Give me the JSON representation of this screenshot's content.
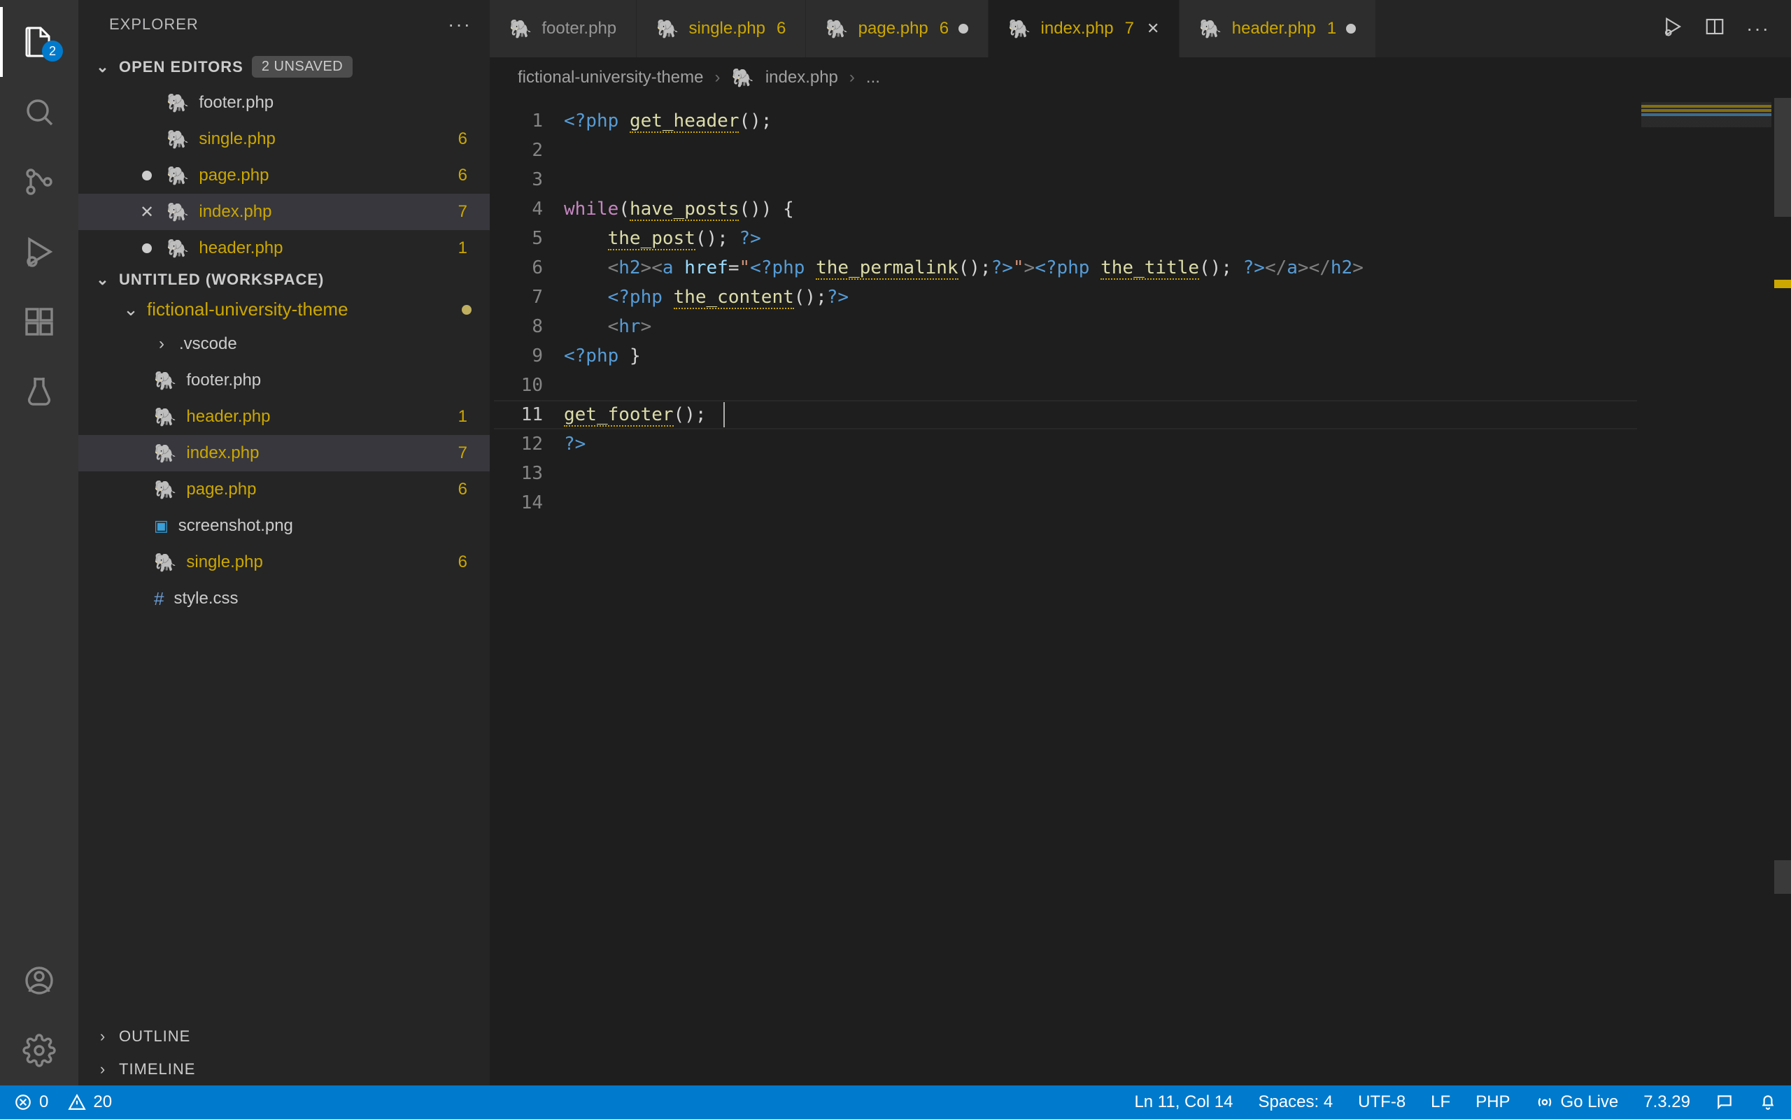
{
  "sidebar": {
    "title": "EXPLORER",
    "openEditors": {
      "header": "OPEN EDITORS",
      "unsaved": "2 UNSAVED",
      "items": [
        {
          "name": "footer.php",
          "mod": false,
          "dirty": false,
          "badge": ""
        },
        {
          "name": "single.php",
          "mod": true,
          "dirty": false,
          "badge": "6"
        },
        {
          "name": "page.php",
          "mod": true,
          "dirty": true,
          "badge": "6"
        },
        {
          "name": "index.php",
          "mod": true,
          "dirty": false,
          "badge": "7",
          "active": true
        },
        {
          "name": "header.php",
          "mod": true,
          "dirty": true,
          "badge": "1"
        }
      ]
    },
    "workspace": {
      "header": "UNTITLED (WORKSPACE)",
      "project": "fictional-university-theme",
      "items": [
        {
          "name": ".vscode",
          "type": "folder"
        },
        {
          "name": "footer.php",
          "type": "php"
        },
        {
          "name": "header.php",
          "type": "php",
          "mod": true,
          "badge": "1"
        },
        {
          "name": "index.php",
          "type": "php",
          "mod": true,
          "badge": "7",
          "active": true
        },
        {
          "name": "page.php",
          "type": "php",
          "mod": true,
          "badge": "6"
        },
        {
          "name": "screenshot.png",
          "type": "img"
        },
        {
          "name": "single.php",
          "type": "php",
          "mod": true,
          "badge": "6"
        },
        {
          "name": "style.css",
          "type": "css"
        }
      ]
    },
    "outline": "OUTLINE",
    "timeline": "TIMELINE"
  },
  "tabs": [
    {
      "name": "footer.php",
      "mod": false,
      "badge": "",
      "dirty": false
    },
    {
      "name": "single.php",
      "mod": true,
      "badge": "6",
      "dirty": false
    },
    {
      "name": "page.php",
      "mod": true,
      "badge": "6",
      "dirty": true
    },
    {
      "name": "index.php",
      "mod": true,
      "badge": "7",
      "dirty": false,
      "active": true
    },
    {
      "name": "header.php",
      "mod": true,
      "badge": "1",
      "dirty": true
    }
  ],
  "breadcrumbs": {
    "root": "fictional-university-theme",
    "file": "index.php",
    "tail": "..."
  },
  "code": {
    "lines": [
      {
        "n": 1,
        "html": "<span class='tok-tag'>&lt;?php</span> <span class='tok-fn'>get_header</span><span class='tok-paren'>()</span><span class='tok-var'>;</span>"
      },
      {
        "n": 2,
        "html": ""
      },
      {
        "n": 3,
        "html": ""
      },
      {
        "n": 4,
        "html": "<span class='tok-kw'>while</span><span class='tok-paren'>(</span><span class='tok-fn'>have_posts</span><span class='tok-paren'>())</span> <span class='tok-paren'>{</span>"
      },
      {
        "n": 5,
        "html": "    <span class='tok-fn'>the_post</span><span class='tok-paren'>()</span><span class='tok-var'>;</span> <span class='tok-tag'>?&gt;</span>"
      },
      {
        "n": 6,
        "html": "    <span class='tok-delim'>&lt;</span><span class='tok-tag'>h2</span><span class='tok-delim'>&gt;&lt;</span><span class='tok-tag'>a</span> <span class='tok-attr'>href</span><span class='tok-var'>=</span><span class='tok-str'>\"</span><span class='tok-tag'>&lt;?php</span> <span class='tok-fn'>the_permalink</span><span class='tok-paren'>()</span><span class='tok-var'>;</span><span class='tok-tag'>?&gt;</span><span class='tok-str'>\"</span><span class='tok-delim'>&gt;</span><span class='tok-tag'>&lt;?php</span> <span class='tok-fn'>the_title</span><span class='tok-paren'>()</span><span class='tok-var'>;</span> <span class='tok-tag'>?&gt;</span><span class='tok-delim'>&lt;/</span><span class='tok-tag'>a</span><span class='tok-delim'>&gt;&lt;/</span><span class='tok-tag'>h2</span><span class='tok-delim'>&gt;</span>"
      },
      {
        "n": 7,
        "html": "    <span class='tok-tag'>&lt;?php</span> <span class='tok-fn'>the_content</span><span class='tok-paren'>()</span><span class='tok-var'>;</span><span class='tok-tag'>?&gt;</span>"
      },
      {
        "n": 8,
        "html": "    <span class='tok-delim'>&lt;</span><span class='tok-tag'>hr</span><span class='tok-delim'>&gt;</span>"
      },
      {
        "n": 9,
        "html": "<span class='tok-tag'>&lt;?php</span> <span class='tok-paren'>}</span>"
      },
      {
        "n": 10,
        "html": ""
      },
      {
        "n": 11,
        "html": "<span class='tok-fn'>get_footer</span><span class='tok-paren'>()</span><span class='tok-var'>;</span>",
        "current": true
      },
      {
        "n": 12,
        "html": "<span class='tok-tag'>?&gt;</span>"
      },
      {
        "n": 13,
        "html": ""
      },
      {
        "n": 14,
        "html": ""
      }
    ]
  },
  "activitybar": {
    "badge": "2"
  },
  "statusbar": {
    "errors": "0",
    "warnings": "20",
    "position": "Ln 11, Col 14",
    "spaces": "Spaces: 4",
    "encoding": "UTF-8",
    "eol": "LF",
    "lang": "PHP",
    "golive": "Go Live",
    "phpver": "7.3.29"
  }
}
